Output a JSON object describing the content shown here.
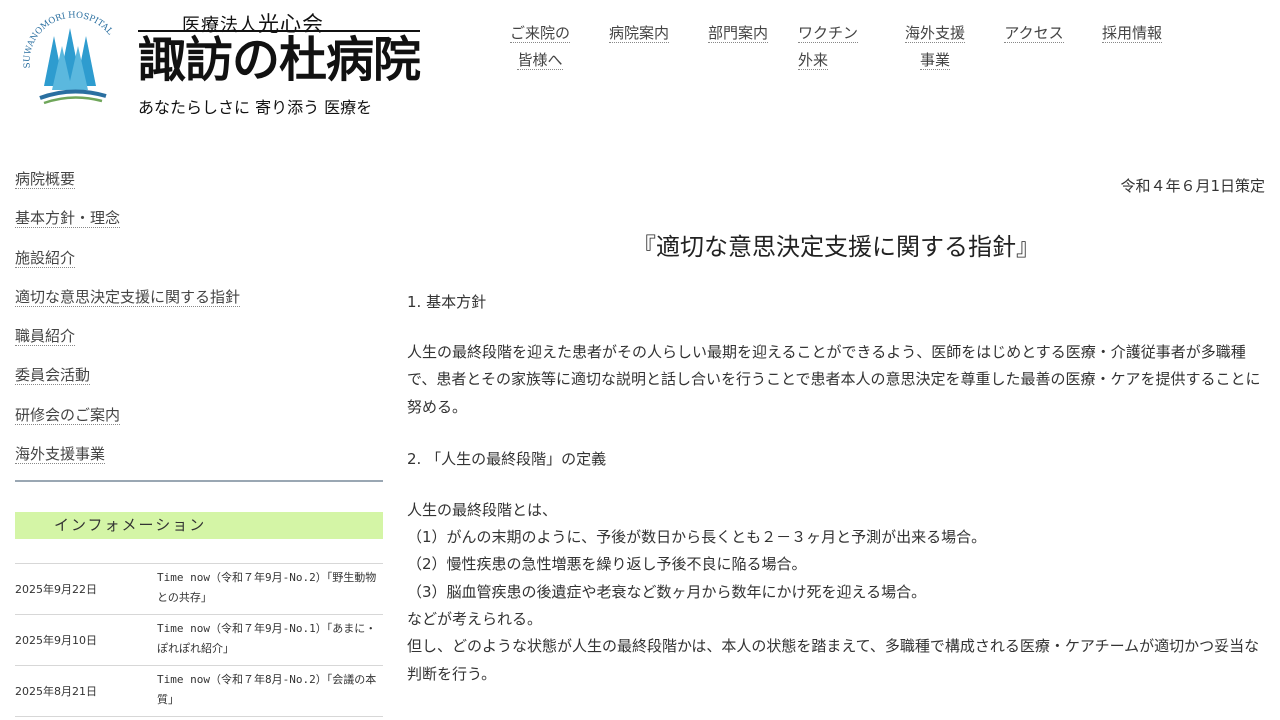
{
  "logo": {
    "emblem_text": "SUWANOMORI HOSPITAL",
    "corp_prefix": "医療法人",
    "corp_name": "光心会",
    "hospital_name": "諏訪の杜病院",
    "tagline": "あなたらしさに 寄り添う 医療を",
    "colors": {
      "tree": "#2e9ccf",
      "wave": "#2a6fa0",
      "wave2": "#6fa65a"
    }
  },
  "gnav": {
    "items": [
      {
        "line1": "ご来院の",
        "line2": "皆様へ"
      },
      {
        "line1": "病院案内",
        "line2": ""
      },
      {
        "line1": "部門案内",
        "line2": ""
      },
      {
        "line1": "ワクチン",
        "line2": "外来"
      },
      {
        "line1": "海外支援",
        "line2": "事業"
      },
      {
        "line1": "アクセス",
        "line2": ""
      },
      {
        "line1": "採用情報",
        "line2": ""
      }
    ]
  },
  "sidebar": {
    "items": [
      {
        "label": "病院概要"
      },
      {
        "label": "基本方針・理念"
      },
      {
        "label": "施設紹介"
      },
      {
        "label": "適切な意思決定支援に関する指針"
      },
      {
        "label": "職員紹介"
      },
      {
        "label": "委員会活動"
      },
      {
        "label": "研修会のご案内"
      },
      {
        "label": "海外支援事業"
      }
    ],
    "info_heading": "インフォメーション",
    "info_color": "#d4f5a6",
    "news": [
      {
        "date": "2025年9月22日",
        "title": "Time now（令和７年9月-No.2）「野生動物との共存」"
      },
      {
        "date": "2025年9月10日",
        "title": "Time now（令和７年9月-No.1）「あまに・ぽれぽれ紹介」"
      },
      {
        "date": "2025年8月21日",
        "title": "Time now（令和７年8月-No.2）「会議の本質」"
      }
    ]
  },
  "main": {
    "date_line": "令和４年６月1日策定",
    "title": "『適切な意思決定支援に関する指針』",
    "section1_heading": "1. 基本方針",
    "section1_body": "人生の最終段階を迎えた患者がその人らしい最期を迎えることができるよう、医師をはじめとする医療・介護従事者が多職種で、患者とその家族等に適切な説明と話し合いを行うことで患者本人の意思決定を尊重した最善の医療・ケアを提供することに努める。",
    "section2_heading": "2. 「人生の最終段階」の定義",
    "section2_intro": "人生の最終段階とは、",
    "section2_items": [
      "（1）がんの末期のように、予後が数日から長くとも２－３ヶ月と予測が出来る場合。",
      "（2）慢性疾患の急性増悪を繰り返し予後不良に陥る場合。",
      "（3）脳血管疾患の後遺症や老衰など数ヶ月から数年にかけ死を迎える場合。"
    ],
    "section2_outro": "などが考えられる。",
    "section2_note": "但し、どのような状態が人生の最終段階かは、本人の状態を踏まえて、多職種で構成される医療・ケアチームが適切かつ妥当な判断を行う。"
  }
}
